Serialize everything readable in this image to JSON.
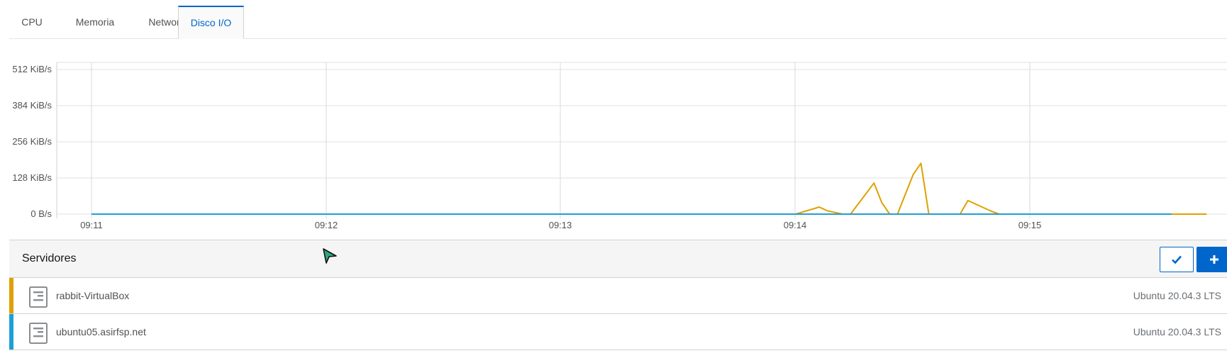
{
  "tabs": [
    {
      "label": "CPU"
    },
    {
      "label": "Memoria"
    },
    {
      "label": "Network"
    },
    {
      "label": "Disco I/O"
    }
  ],
  "active_tab": "Disco I/O",
  "chart_data": {
    "type": "line",
    "title": "",
    "xlabel": "",
    "ylabel": "",
    "x_tick_labels": [
      "09:11",
      "09:12",
      "09:13",
      "09:14",
      "09:15"
    ],
    "y_tick_labels": [
      "512 KiB/s",
      "384 KiB/s",
      "256 KiB/s",
      "128 KiB/s",
      "0 B/s"
    ],
    "y_tick_values": [
      512,
      384,
      256,
      128,
      0
    ],
    "ylim": [
      0,
      512
    ],
    "x_unit": "seconds after 09:11",
    "xlim": [
      -15,
      277
    ],
    "grid": true,
    "series": [
      {
        "color": "#e0a000",
        "x": [
          0,
          180,
          186,
          188,
          192,
          194,
          200,
          202,
          204,
          206,
          210,
          212,
          214,
          220,
          222,
          224,
          230,
          232,
          234,
          236,
          238,
          240,
          276,
          278,
          281,
          282,
          285
        ],
        "y": [
          0,
          0,
          25,
          12,
          0,
          0,
          110,
          40,
          0,
          0,
          140,
          180,
          0,
          0,
          0,
          48,
          10,
          0,
          0,
          0,
          0,
          0,
          0,
          0,
          0,
          0,
          0
        ]
      },
      {
        "color": "#1e9fd5",
        "x": [
          0,
          276
        ],
        "y": [
          0,
          0
        ]
      }
    ]
  },
  "servers": {
    "title": "Servidores",
    "check_icon": "check-icon",
    "add_icon": "plus-icon",
    "items": [
      {
        "name": "rabbit-VirtualBox",
        "os": "Ubuntu 20.04.3 LTS",
        "color": "#e0a000"
      },
      {
        "name": "ubuntu05.asirfsp.net",
        "os": "Ubuntu 20.04.3 LTS",
        "color": "#1e9fd5"
      }
    ]
  }
}
